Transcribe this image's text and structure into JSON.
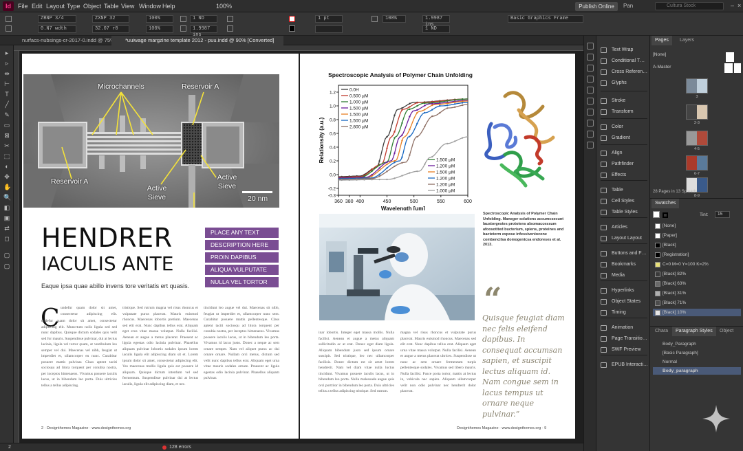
{
  "app": {
    "logo": "Id"
  },
  "menu": [
    "File",
    "Edit",
    "Layout",
    "Type",
    "Object",
    "Table",
    "View",
    "Window",
    "Help"
  ],
  "menu_right": {
    "zoom": "100%",
    "publish": "Publish Online",
    "workspace": "Pan",
    "search_placeholder": "Cultura Stock"
  },
  "control": {
    "x": "ZBNP 3/4",
    "y": "0.N7 wdth",
    "w": "ZXNP 32",
    "h": "32.07 r0",
    "stroke": "1 pt",
    "percent1": "100%",
    "percent2": "100%",
    "measure1": "1 ND",
    "measure2": "1.9987 ins",
    "frame_type": "Basic Graphics Frame"
  },
  "tabs": [
    {
      "label": "nurfacs-nubsings-cr-2017-0.indd @ 75%"
    },
    {
      "label": "*uuiwage margzine template 2012 - puu.indd @ 90% [Converted]"
    }
  ],
  "page_left": {
    "sem_labels": [
      "Microchannels",
      "Reservoir A",
      "Reservoir A",
      "Active Sieve",
      "Active Sieve",
      "20 nm"
    ],
    "headline1": "HENDRER",
    "headline2": "IACULIS ANTE",
    "subhead": "Eaque ipsa quae abillo invens tore veritatis ert quasis.",
    "purple_bars": [
      "PLACE ANY TEXT",
      "DESCRIPTION HERE",
      "PROIN DAPIBUS",
      "ALIQUA VULPUTATE",
      "NULLA VEL TORTOR"
    ],
    "drop_cap": "C",
    "col1": "undefur quam dolor sit amet, consectetur adipiscing elit. Muncrtum nolis ligula sed sed nunc dapibus. Quisque dictum sodales quis velit sed for mauris. Suspendisse pulvinar, dui at lectus lacinia, ligula vel tortor quam, at vestibulum leo semper vel dui. Maecenas vel nibh, feugiat ut imperdiet et, ullamcorper eu nunc. Curabitur posuere mattis pulvinar. Class aptent taciti sociosqu ad litora torquent per conubia nostra, per inceptos himenaeos. Vivamus posuere iaculis lacus, ut in bibendum leo porta. Duis ultricies tellus a tellus adipiscing.",
    "col2": "tristique. Sed rutrum magna vel risus rhoncus et vulputate purus placerat. Mauris euismod rhoncus. Maecenas lobortis pretium. Maecenas sed elit erat. Nunc dapibus tellus erat. Aliquam eget eros vitae massa volutpat. Nulla facilisi. Aenean et augue a metus placerat. Praesent ac ligula egestas odio lacinia pulvinar. Phasellus aliquam pulvinar lobortis sodales ipsum lorem iaculis ligula elit adipiscing diam sit et. Lorem ipsum dolor sit amet, consectetur adipiscing elit. Ves maecenas mollis ligula quis est posuere id aliquam. Quisque dictum interdum vel sed fermentum. Suspendisse pulvinar dui at lectus iaculis, ligula elit adipiscing diam, et nec.",
    "col3": "tincidunt leo augue vel dui. Maecenas sit nibh, feugiat ut imperdiet et, ullamcorper nunc sem. Curabitur posuere mattis pellentesque. Class aptent taciti sociosqu ad litora torquent per conubia nostra, per inceptos himenaeos. Vivamus posuere iaculis lacus, ut in bibendum leo porta. Vivamus id lacus justo. Donec a neque ac sem ornare semper. Nam vel aliquet purus ac dui ornare ornare. Nullam orci metus, dictum sed velit nunc dapibus tellus erat. Aliquam eget urna vitae mauris sodales ornare. Praesent ac ligula egestas odio lacinia pulvinar. Phasellus aliquam pulvinar.",
    "folio": "2 · Designthemes Magazine · www.designthemes.org"
  },
  "page_right": {
    "chart_title": "Spectroscopic Analysis of Polymer Chain Unfolding",
    "caption": "Spectroscopic Analysis of Polymer Chain Unfolding. Maneger solutions accumcsecunt laustorgestes prototens alsomaccessum afoosotited bucterium, spiens, proteines and bacteterm expose infessiveniocone combencilsa domogenicsa endoreses et al. 2013.",
    "quote_mark": "“",
    "quote": "Quisque feugiat diam nec felis eleifend dapibus. In consequat accumsan sapien, et suscipit lectus aliquam id. Nam congue sem in lacus tempus ut ornare neque pulvinar.”",
    "col1": "inar lobortis. Integer eget massa mollis. Nulla facilisi. Aenean et augue a metus aliquam sollicitudin ac at erat. Donec eget diam ligula. Aliquam bibendum justo sed ipsum ornare suscipit. Sed tristique, leo nec ullamcorper facilisis. Donec dictum est sit amet lorem hendrerit. Nam vel diam vitae nulla luctus tincidunt. Vivamus posuere iaculis lacus, ut in bibendum leo porta. Nulla malesuada augue quis orci porttitor in bibendum leo porta. Duis ultricies tellus a tellus adipiscing tristique. Sed rutrum.",
    "col2": "magna vel risus rhoncus et vulputate purus placerat. Mauris euismod rhoncus. Maecenas sed elit erat. Nunc dapibus tellus erat. Aliquam eget urna vitae massa volutpat. Nulla facilisi. Aenean et augue a metus placerat ultrices. Suspendisse ut nunc ac sem ornare fermentum turpis pellentesque sodales. Vivamus sed libero mauris. Nulla facilisi. Fusce porta tortor, mattis at lectus in, vehicula nec sapien. Aliquam ullamcorper velit non odio pulvinar nec hendrerit dolor placerat.",
    "folio": "Designthemes Magazine · www.designthemes.org · 9"
  },
  "chart_data": {
    "type": "line",
    "title": "Spectroscopic Analysis of Polymer Chain Unfolding",
    "xlabel": "Wavelength [um]",
    "ylabel": "Relationsity (a.u.)",
    "xlim": [
      360,
      600
    ],
    "ylim": [
      -0.3,
      1.3
    ],
    "xticks": [
      360,
      380,
      400,
      450,
      500,
      550,
      600
    ],
    "xtick_labels": [
      "360",
      "380",
      "400",
      "450",
      "500",
      "550",
      "600"
    ],
    "yticks": [
      -0.3,
      -0.2,
      0.0,
      0.2,
      0.4,
      0.6,
      0.8,
      1.0,
      1.2
    ],
    "ytick_labels": [
      "-0.3",
      "-0.2",
      "0.0",
      "0.2",
      "0.4",
      "0.6",
      "0.8",
      "1.0",
      "1.2"
    ],
    "legend_top": [
      "0.0H",
      "0.500 µM",
      "1.000 µM",
      "1.500 µM",
      "1.500 µM",
      "1.500 µM",
      "2.800 µM"
    ],
    "legend_bottom": [
      "1.500 µM",
      "1.200 µM",
      "1.500 µM",
      "1.200 µM",
      "1.200 µM",
      "1.000 µM"
    ],
    "series": [
      {
        "color": "#3b3b3b",
        "midpoint": 450,
        "values": [
          [
            360,
            -0.03
          ],
          [
            400,
            -0.02
          ],
          [
            430,
            0.1
          ],
          [
            450,
            0.55
          ],
          [
            470,
            0.95
          ],
          [
            500,
            1.05
          ],
          [
            600,
            1.1
          ]
        ]
      },
      {
        "color": "#c0392b",
        "midpoint": 458,
        "values": [
          [
            360,
            -0.04
          ],
          [
            400,
            -0.03
          ],
          [
            440,
            0.15
          ],
          [
            458,
            0.55
          ],
          [
            480,
            0.95
          ],
          [
            510,
            1.05
          ],
          [
            600,
            1.1
          ]
        ]
      },
      {
        "color": "#2e7d32",
        "midpoint": 466,
        "values": [
          [
            360,
            -0.05
          ],
          [
            400,
            -0.04
          ],
          [
            450,
            0.18
          ],
          [
            466,
            0.55
          ],
          [
            490,
            0.95
          ],
          [
            520,
            1.04
          ],
          [
            600,
            1.1
          ]
        ]
      },
      {
        "color": "#6a1b9a",
        "midpoint": 474,
        "values": [
          [
            360,
            -0.05
          ],
          [
            410,
            -0.04
          ],
          [
            458,
            0.2
          ],
          [
            474,
            0.55
          ],
          [
            500,
            0.93
          ],
          [
            530,
            1.03
          ],
          [
            600,
            1.08
          ]
        ]
      },
      {
        "color": "#e67e22",
        "midpoint": 482,
        "values": [
          [
            360,
            -0.06
          ],
          [
            410,
            -0.05
          ],
          [
            466,
            0.2
          ],
          [
            482,
            0.55
          ],
          [
            510,
            0.92
          ],
          [
            540,
            1.02
          ],
          [
            600,
            1.07
          ]
        ]
      },
      {
        "color": "#1565c0",
        "midpoint": 490,
        "values": [
          [
            360,
            -0.06
          ],
          [
            420,
            -0.05
          ],
          [
            474,
            0.2
          ],
          [
            490,
            0.55
          ],
          [
            520,
            0.9
          ],
          [
            550,
            1.0
          ],
          [
            600,
            1.05
          ]
        ]
      },
      {
        "color": "#8d6e63",
        "midpoint": 505,
        "values": [
          [
            360,
            -0.07
          ],
          [
            420,
            -0.06
          ],
          [
            485,
            0.18
          ],
          [
            505,
            0.55
          ],
          [
            535,
            0.85
          ],
          [
            565,
            0.97
          ],
          [
            600,
            1.02
          ]
        ]
      },
      {
        "color": "#9e9e9e",
        "midpoint": 530,
        "values": [
          [
            360,
            -0.08
          ],
          [
            450,
            -0.07
          ],
          [
            510,
            0.05
          ],
          [
            530,
            0.25
          ],
          [
            560,
            0.45
          ],
          [
            600,
            0.55
          ]
        ]
      }
    ]
  },
  "panel_list": [
    {
      "label": "Text Wrap",
      "icon": "text-wrap-icon"
    },
    {
      "label": "Conditional T…",
      "icon": "conditional-text-icon"
    },
    {
      "label": "Cross Referen…",
      "icon": "cross-reference-icon"
    },
    {
      "label": "Glyphs",
      "icon": "glyphs-icon"
    },
    {
      "label": "Stroke",
      "icon": "stroke-icon"
    },
    {
      "label": "Transform",
      "icon": "transform-icon"
    },
    {
      "label": "Color",
      "icon": "color-icon"
    },
    {
      "label": "Gradient",
      "icon": "gradient-icon"
    },
    {
      "label": "Align",
      "icon": "align-icon"
    },
    {
      "label": "Pathfinder",
      "icon": "pathfinder-icon"
    },
    {
      "label": "Effects",
      "icon": "effects-icon"
    },
    {
      "label": "Table",
      "icon": "table-icon"
    },
    {
      "label": "Cell Styles",
      "icon": "cell-styles-icon"
    },
    {
      "label": "Table Styles",
      "icon": "table-styles-icon"
    },
    {
      "label": "Articles",
      "icon": "articles-icon"
    },
    {
      "label": "Layout Layout",
      "icon": "layout-icon"
    },
    {
      "label": "Buttons and F…",
      "icon": "buttons-icon"
    },
    {
      "label": "Bookmarks",
      "icon": "bookmarks-icon"
    },
    {
      "label": "Media",
      "icon": "media-icon"
    },
    {
      "label": "Hyperlinks",
      "icon": "hyperlinks-icon"
    },
    {
      "label": "Object States",
      "icon": "object-states-icon"
    },
    {
      "label": "Timing",
      "icon": "timing-icon"
    },
    {
      "label": "Animation",
      "icon": "animation-icon"
    },
    {
      "label": "Page Transitio…",
      "icon": "page-transition-icon"
    },
    {
      "label": "SWF Preview",
      "icon": "swf-preview-icon"
    },
    {
      "label": "EPUB Interacti…",
      "icon": "epub-icon"
    }
  ],
  "pages_panel": {
    "tabs": [
      "Pages",
      "Layers"
    ],
    "none": "[None]",
    "master": "A-Master",
    "spreads": [
      "3",
      "2-3",
      "4-5",
      "6-7",
      "8-9"
    ],
    "footer": "28 Pages in 13 Spreads"
  },
  "swatches_panel": {
    "tab": "Swatches",
    "tint_label": "Tint:",
    "tint_value": "15",
    "items": [
      {
        "name": "[None]",
        "color": "#ffffff"
      },
      {
        "name": "[Paper]",
        "color": "#ffffff"
      },
      {
        "name": "[Black]",
        "color": "#000000"
      },
      {
        "name": "[Registration]",
        "color": "#000000"
      },
      {
        "name": "C=0 M=0 Y=100 K=2%",
        "color": "#e8e078"
      },
      {
        "name": "[Black] 82%",
        "color": "#3a3a3a"
      },
      {
        "name": "[Black] 63%",
        "color": "#6a6a6a"
      },
      {
        "name": "[Black] 31%",
        "color": "#b0b0b0"
      },
      {
        "name": "[Black] 71%",
        "color": "#4c4c4c"
      },
      {
        "name": "[Black] 10%",
        "color": "#e6e6e6"
      }
    ]
  },
  "para_panel": {
    "tabs": [
      "Chara",
      "Paragraph Styles",
      "Object"
    ],
    "items": [
      "Body_Paragraph",
      "[Basic Paragraph]",
      "Normal",
      "Body_paragraph"
    ]
  },
  "status": {
    "page": "2",
    "errors": "128 errors"
  }
}
